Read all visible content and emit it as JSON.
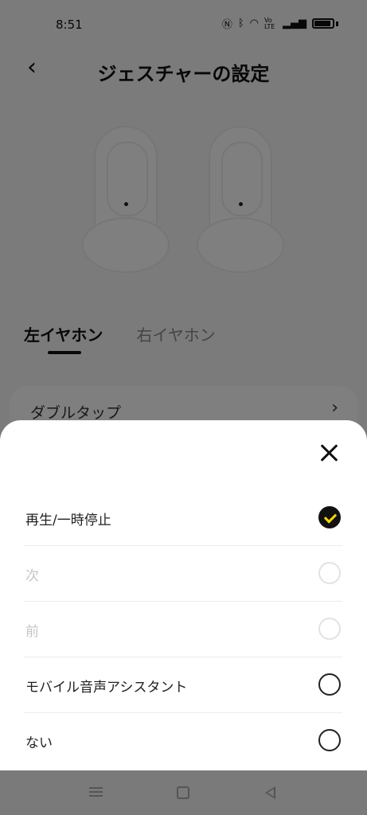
{
  "status_bar": {
    "time": "8:51",
    "icons": [
      "nfc-icon",
      "bluetooth-icon",
      "wifi-icon",
      "volte-icon",
      "signal-icon",
      "battery-icon"
    ],
    "volte_text": "Vo LTE"
  },
  "header": {
    "title": "ジェスチャーの設定"
  },
  "tabs": [
    {
      "label": "左イヤホン",
      "active": true
    },
    {
      "label": "右イヤホン",
      "active": false
    }
  ],
  "settings": {
    "double_tap_label": "ダブルタップ"
  },
  "sheet": {
    "options": [
      {
        "label": "再生/一時停止",
        "selected": true,
        "enabled": true
      },
      {
        "label": "次",
        "selected": false,
        "enabled": false
      },
      {
        "label": "前",
        "selected": false,
        "enabled": false
      },
      {
        "label": "モバイル音声アシスタント",
        "selected": false,
        "enabled": true
      },
      {
        "label": "ない",
        "selected": false,
        "enabled": true
      }
    ]
  },
  "colors": {
    "check_accent": "#ffd800",
    "overlay": "rgba(0,0,0,0.5)"
  }
}
